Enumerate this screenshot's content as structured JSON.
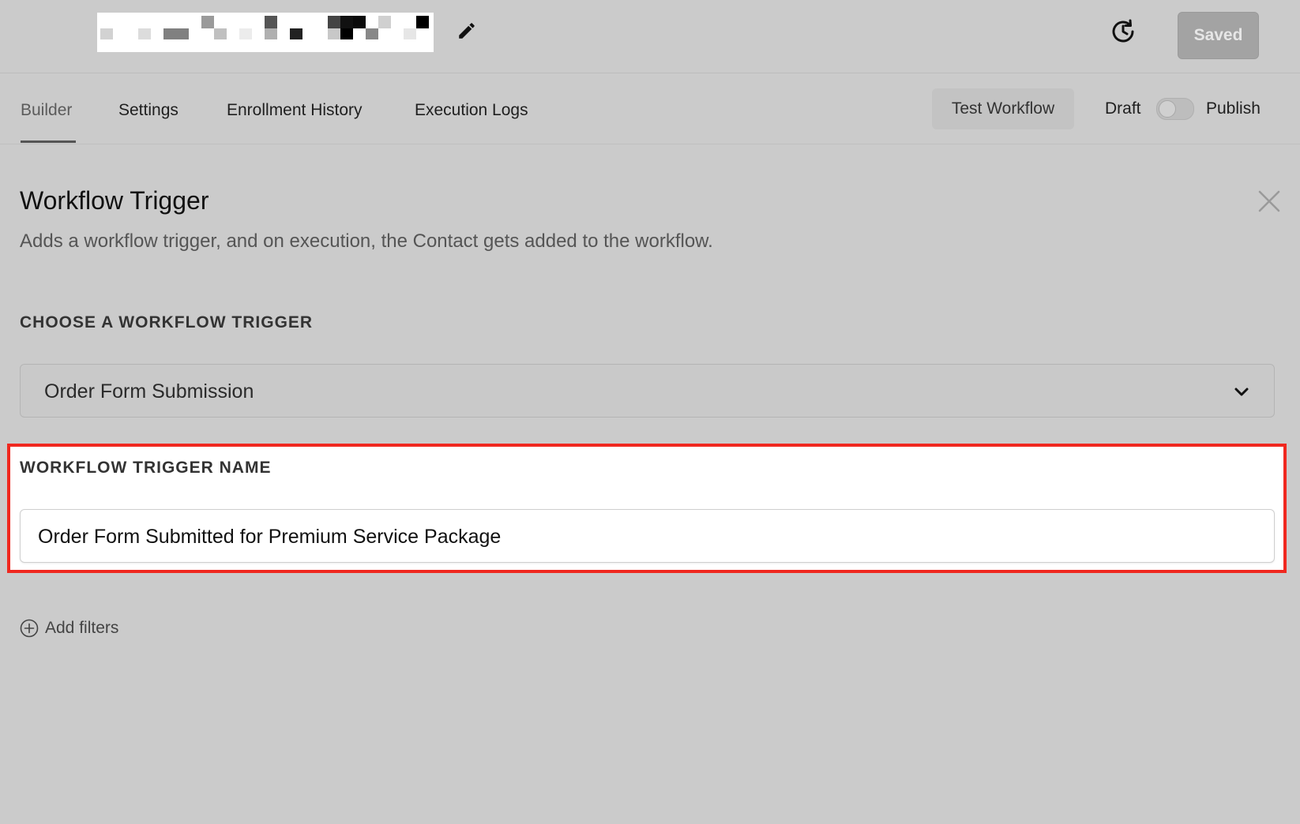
{
  "header": {
    "saved_label": "Saved"
  },
  "tabs": [
    {
      "label": "Builder",
      "active": true
    },
    {
      "label": "Settings"
    },
    {
      "label": "Enrollment History"
    },
    {
      "label": "Execution Logs"
    }
  ],
  "actions": {
    "test_label": "Test Workflow",
    "draft_label": "Draft",
    "publish_label": "Publish",
    "publish_toggle_on": false
  },
  "panel": {
    "title": "Workflow Trigger",
    "description": "Adds a workflow trigger, and on execution, the Contact gets added to the workflow.",
    "choose_label": "CHOOSE A WORKFLOW TRIGGER",
    "selected_trigger": "Order Form Submission",
    "name_label": "WORKFLOW TRIGGER NAME",
    "name_value": "Order Form Submitted for Premium Service Package",
    "add_filters_label": "Add filters"
  },
  "colors": {
    "background": "#cbcbcb",
    "highlight_border": "#f0281f",
    "saved_button": "#a3a3a3"
  },
  "icons": [
    "pencil-icon",
    "history-icon",
    "close-icon",
    "chevron-down-icon",
    "plus-circle-icon"
  ]
}
